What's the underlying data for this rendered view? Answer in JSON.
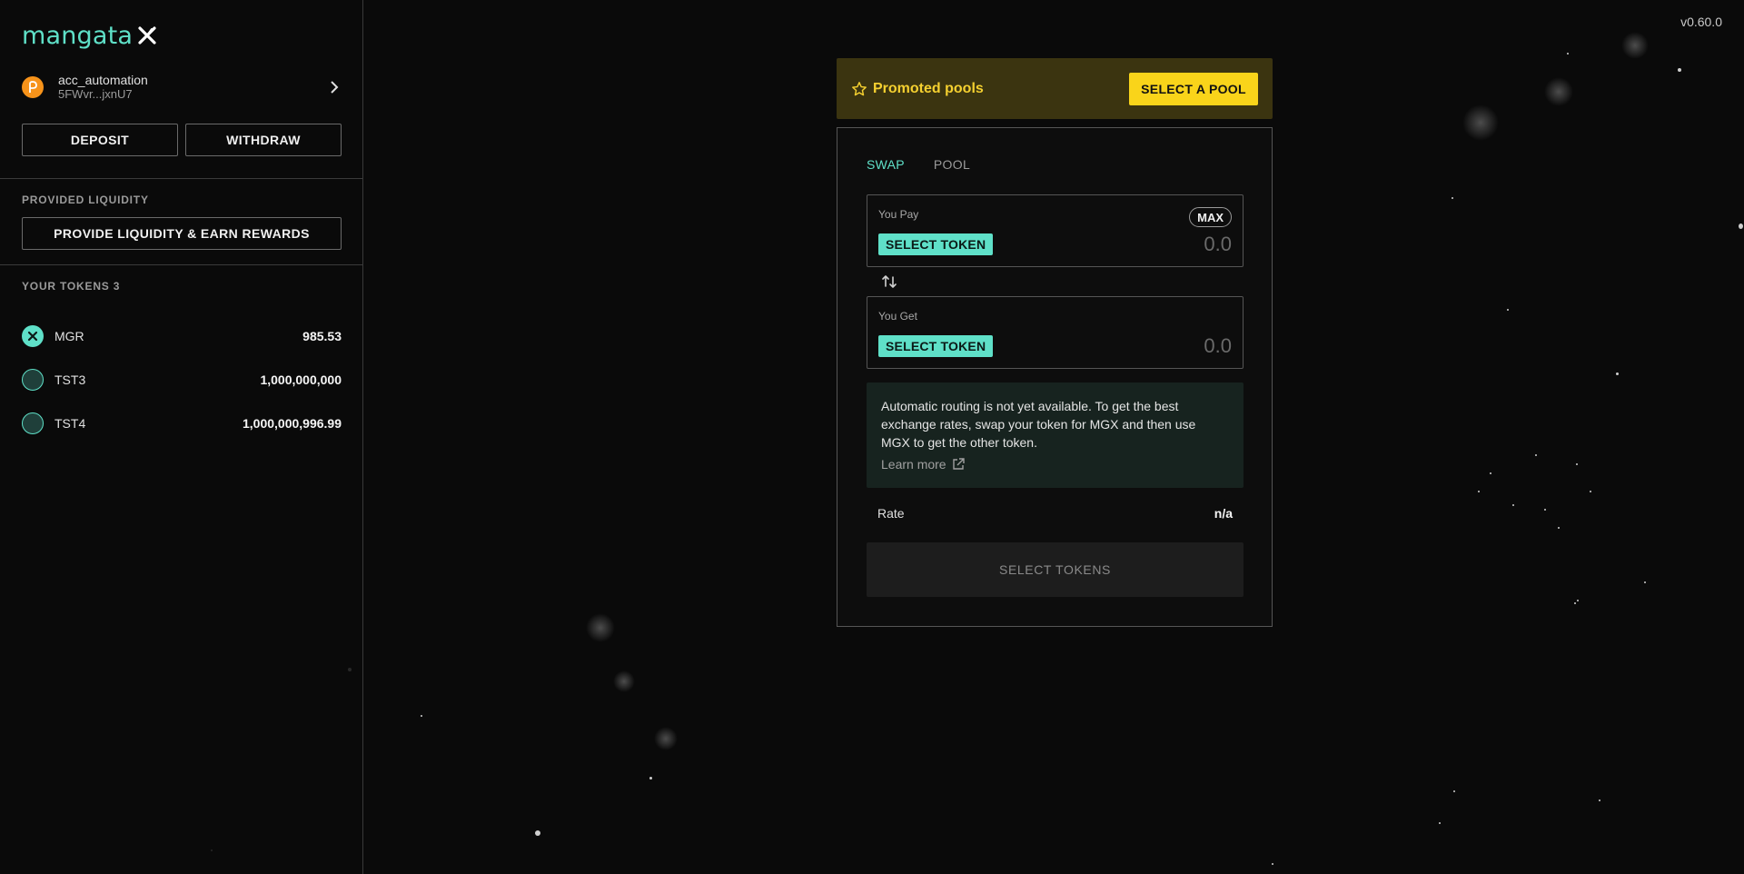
{
  "app": {
    "logo_text": "mangata",
    "version": "v0.60.0",
    "accent": "#5fe0c8",
    "highlight": "#f9d41a"
  },
  "sidebar": {
    "account": {
      "name": "acc_automation",
      "address": "5FWvr...jxnU7",
      "icon": "polkadot-icon"
    },
    "deposit_label": "DEPOSIT",
    "withdraw_label": "WITHDRAW",
    "provided_liquidity_label": "PROVIDED LIQUIDITY",
    "provide_liquidity_button": "PROVIDE LIQUIDITY & EARN REWARDS",
    "your_tokens_label": "YOUR TOKENS 3",
    "tokens": [
      {
        "symbol": "MGR",
        "balance": "985.53",
        "icon": "mangata-token-icon"
      },
      {
        "symbol": "TST3",
        "balance": "1,000,000,000",
        "icon": "generic-token-icon"
      },
      {
        "symbol": "TST4",
        "balance": "1,000,000,996.99",
        "icon": "generic-token-icon"
      }
    ]
  },
  "promoted": {
    "title": "Promoted pools",
    "button": "SELECT A POOL"
  },
  "swap": {
    "tabs": [
      {
        "label": "SWAP",
        "active": true
      },
      {
        "label": "POOL",
        "active": false
      }
    ],
    "pay": {
      "label": "You Pay",
      "select_token": "SELECT TOKEN",
      "placeholder": "0.0",
      "max_label": "MAX"
    },
    "get": {
      "label": "You Get",
      "select_token": "SELECT TOKEN",
      "placeholder": "0.0"
    },
    "info": {
      "text": "Automatic routing is not yet available. To get the best exchange rates, swap your token for MGX and then use MGX to get the other token.",
      "learn_more": "Learn more"
    },
    "rate": {
      "label": "Rate",
      "value": "n/a"
    },
    "submit_label": "SELECT TOKENS"
  }
}
